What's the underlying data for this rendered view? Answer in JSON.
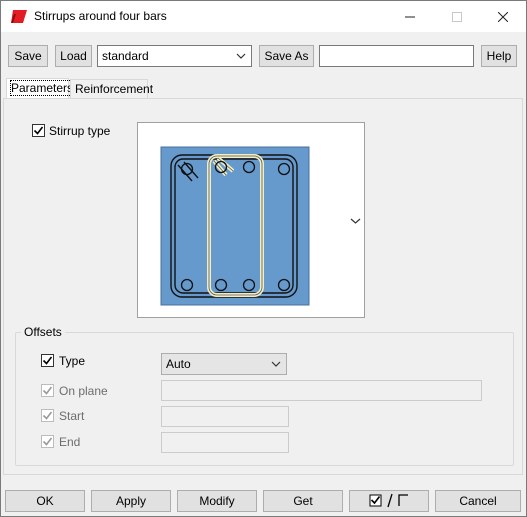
{
  "window": {
    "title": "Stirrups around four bars",
    "minimize_icon": "minimize-icon",
    "maximize_icon": "maximize-icon",
    "close_icon": "close-icon",
    "brand_color": "#e31b23"
  },
  "toolbar": {
    "save_label": "Save",
    "load_label": "Load",
    "profile_value": "standard",
    "save_as_label": "Save As",
    "save_as_value": "",
    "help_label": "Help"
  },
  "tabs": [
    {
      "label": "Parameters",
      "active": true
    },
    {
      "label": "Reinforcement",
      "active": false
    }
  ],
  "stirrup": {
    "checked": true,
    "label": "Stirrup type",
    "preview_icon": "stirrup-preview-image",
    "concrete_color": "#6699cc",
    "stirrup_color": "#f2eec2",
    "dropdown_icon": "chevron-down-icon"
  },
  "offsets": {
    "title": "Offsets",
    "type": {
      "checked": true,
      "label": "Type",
      "value": "Auto",
      "enabled": true
    },
    "on_plane": {
      "checked": true,
      "label": "On plane",
      "value": "",
      "enabled": false
    },
    "start": {
      "checked": true,
      "label": "Start",
      "value": "",
      "enabled": false
    },
    "end": {
      "checked": true,
      "label": "End",
      "value": "",
      "enabled": false
    }
  },
  "footer": {
    "ok_label": "OK",
    "apply_label": "Apply",
    "modify_label": "Modify",
    "get_label": "Get",
    "toggle_icon": "check-uncheck-toggle-icon",
    "cancel_label": "Cancel"
  }
}
